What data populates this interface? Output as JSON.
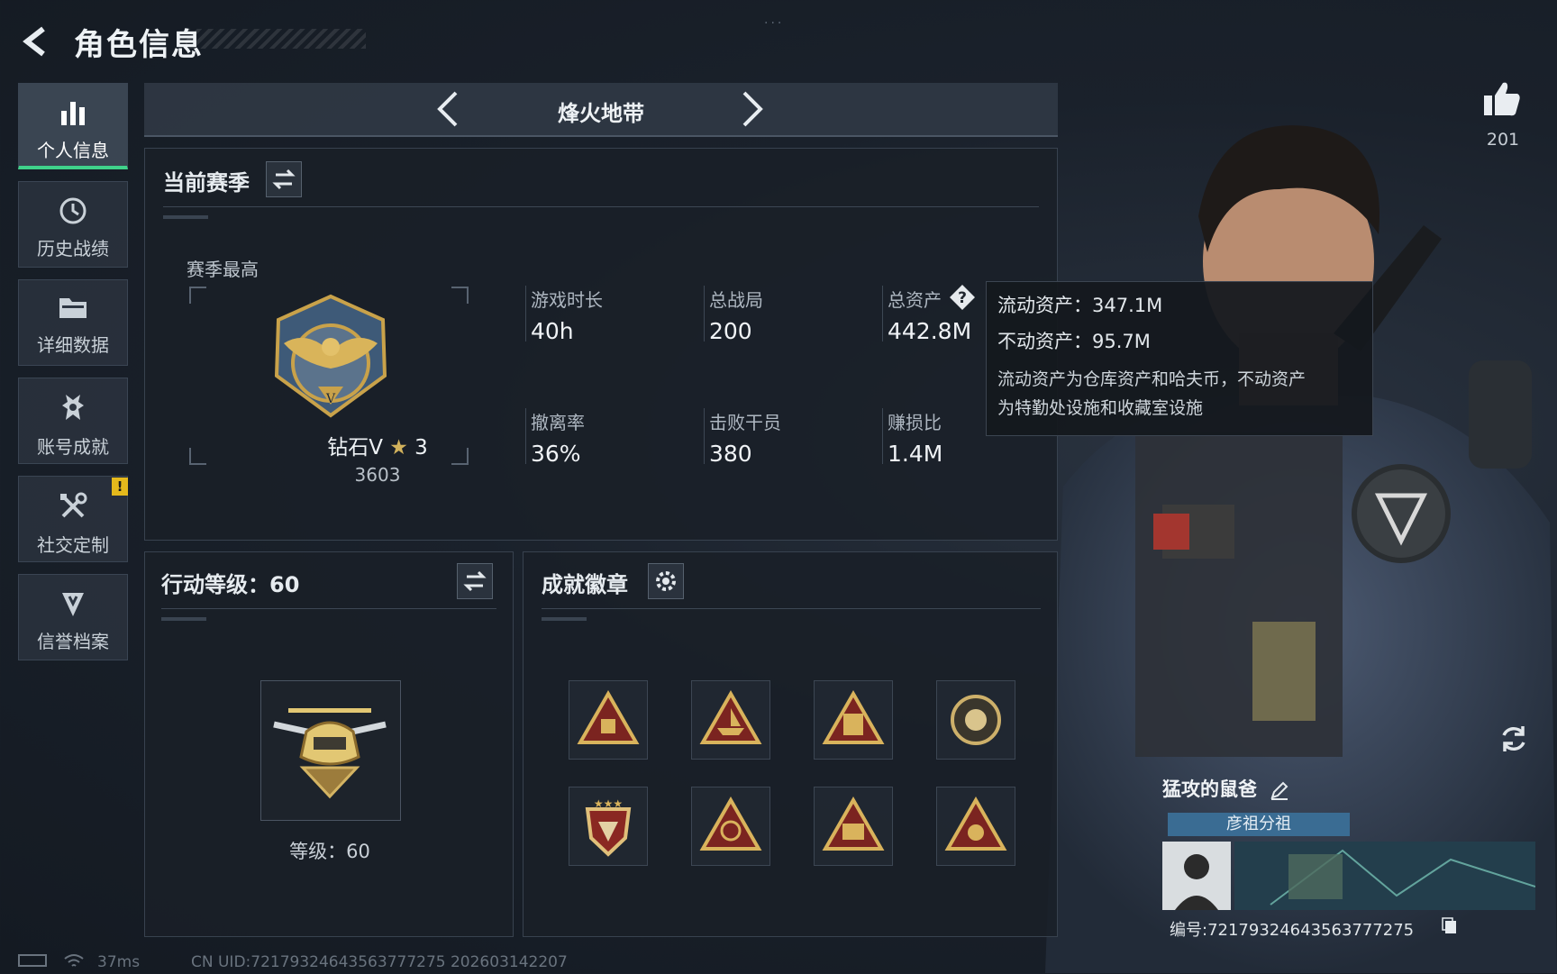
{
  "header": {
    "title": "角色信息",
    "top_dots": "..."
  },
  "sidebar": {
    "items": [
      {
        "label": "个人信息",
        "icon": "bar-chart-icon",
        "active": true
      },
      {
        "label": "历史战绩",
        "icon": "history-clock-icon"
      },
      {
        "label": "详细数据",
        "icon": "folder-icon"
      },
      {
        "label": "账号成就",
        "icon": "achievement-medal-icon"
      },
      {
        "label": "社交定制",
        "icon": "tools-icon",
        "badge": "!"
      },
      {
        "label": "信誉档案",
        "icon": "credit-shield-icon"
      }
    ]
  },
  "mode": {
    "name": "烽火地带"
  },
  "season_panel": {
    "title": "当前赛季",
    "best_label": "赛季最高",
    "rank_name": "钻石V",
    "rank_stars": "3",
    "rank_points": "3603",
    "stats": [
      {
        "label": "游戏时长",
        "value": "40h"
      },
      {
        "label": "总战局",
        "value": "200"
      },
      {
        "label": "总资产",
        "value": "442.8M",
        "help": "?"
      },
      {
        "label": "撤离率",
        "value": "36%"
      },
      {
        "label": "击败干员",
        "value": "380"
      },
      {
        "label": "赚损比",
        "value": "1.4M"
      }
    ]
  },
  "tooltip": {
    "liquid": "流动资产：347.1M",
    "fixed": "不动资产：95.7M",
    "desc_line1": "流动资产为仓库资产和哈夫币，不动资产",
    "desc_line2": "为特勤处设施和收藏室设施"
  },
  "level_panel": {
    "title": "行动等级：60",
    "level_text": "等级：60"
  },
  "achievements_panel": {
    "title": "成就徽章",
    "badges": [
      "badge-1",
      "badge-2",
      "badge-3",
      "badge-4",
      "badge-5",
      "badge-6",
      "badge-7",
      "badge-8"
    ]
  },
  "likes": {
    "count": "201"
  },
  "player": {
    "name": "猛攻的鼠爸",
    "guild": "彦祖分祖",
    "uid": "编号:7217932464356377727​5"
  },
  "footer": {
    "ping": "37ms",
    "uid_time": "CN UID:7217932464356377727​5 202603142207"
  },
  "colors": {
    "accent_green": "#3fd28a",
    "warning": "#e5b91c",
    "guild_blue": "#3a6c93",
    "gold": "#c9a24a"
  }
}
